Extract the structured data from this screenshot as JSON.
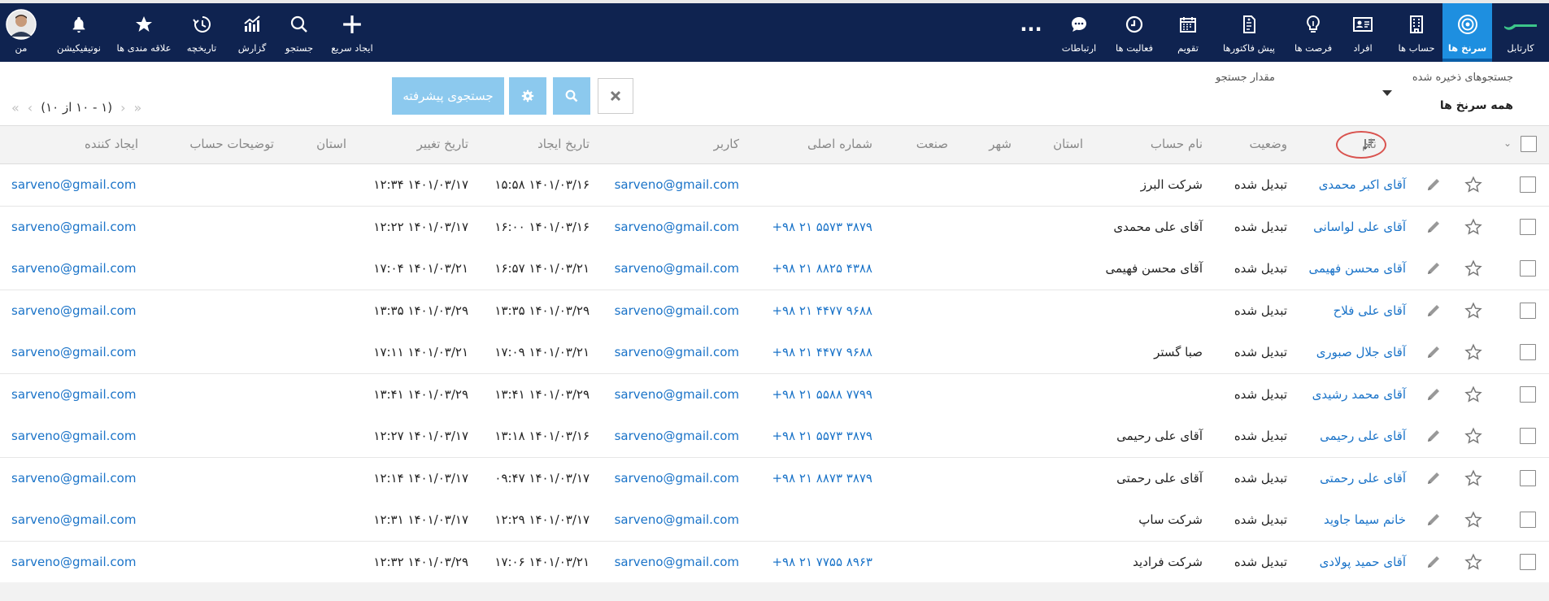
{
  "nav": {
    "items": [
      {
        "label": "کارتابل",
        "icon": "dashboard-logo-icon"
      },
      {
        "label": "سرنخ ها",
        "icon": "target-icon",
        "active": true
      },
      {
        "label": "حساب ها",
        "icon": "building-icon"
      },
      {
        "label": "افراد",
        "icon": "contact-card-icon"
      },
      {
        "label": "فرصت ها",
        "icon": "lightbulb-icon"
      },
      {
        "label": "پیش فاکتورها",
        "icon": "invoice-icon"
      },
      {
        "label": "تقویم",
        "icon": "calendar-icon"
      },
      {
        "label": "فعالیت ها",
        "icon": "clock-icon"
      },
      {
        "label": "ارتباطات",
        "icon": "chat-icon"
      }
    ],
    "more_label": "...",
    "tools": [
      {
        "label": "ایجاد سریع",
        "icon": "plus-icon"
      },
      {
        "label": "جستجو",
        "icon": "search-icon"
      },
      {
        "label": "گزارش",
        "icon": "chart-icon"
      },
      {
        "label": "تاریخچه",
        "icon": "history-icon"
      },
      {
        "label": "علاقه مندی ها",
        "icon": "star-icon"
      },
      {
        "label": "نوتیفیکیشن",
        "icon": "bell-icon"
      },
      {
        "label": "من",
        "icon": "avatar"
      }
    ],
    "accent_color": "#1e8fe0",
    "bar_color": "#0f2350"
  },
  "toolbar": {
    "saved_searches_label": "جستجوهای ذخیره شده",
    "saved_searches_value": "همه سرنخ ها",
    "search_value_label": "مقدار جستجو",
    "clear_icon": "close-icon",
    "search_icon": "search-icon",
    "settings_icon": "gear-icon",
    "advanced_search_label": "جستجوی پیشرفته",
    "pagination_text": "(۱ - ۱۰ از ۱۰)"
  },
  "table": {
    "headers": {
      "name": "نام",
      "status": "وضعیت",
      "account_name": "نام حساب",
      "province": "استان",
      "city": "شهر",
      "industry": "صنعت",
      "main_number": "شماره اصلی",
      "user": "کاربر",
      "created_date": "تاریخ ایجاد",
      "modified_date": "تاریخ تغییر",
      "province2": "استان",
      "account_description": "توضیحات حساب",
      "creator": "ایجاد کننده"
    },
    "rows": [
      {
        "name": "آقای اکبر محمدی",
        "status": "تبدیل شده",
        "account": "شرکت البرز",
        "phone": "",
        "user": "sarveno@gmail.com",
        "created": "۱۵:۵۸ ۱۴۰۱/۰۳/۱۶",
        "modified": "۱۲:۳۴ ۱۴۰۱/۰۳/۱۷",
        "creator": "sarveno@gmail.com"
      },
      {
        "name": "آقای علی لواسانی",
        "status": "تبدیل شده",
        "account": "آقای علی محمدی",
        "phone": "+۹۸ ۲۱ ۵۵۷۳ ۳۸۷۹",
        "user": "sarveno@gmail.com",
        "created": "۱۶:۰۰ ۱۴۰۱/۰۳/۱۶",
        "modified": "۱۲:۲۲ ۱۴۰۱/۰۳/۱۷",
        "creator": "sarveno@gmail.com"
      },
      {
        "name": "آقای محسن فهیمی",
        "status": "تبدیل شده",
        "account": "آقای محسن فهیمی",
        "phone": "+۹۸ ۲۱ ۸۸۲۵ ۴۳۸۸",
        "user": "sarveno@gmail.com",
        "created": "۱۶:۵۷ ۱۴۰۱/۰۳/۲۱",
        "modified": "۱۷:۰۴ ۱۴۰۱/۰۳/۲۱",
        "creator": "sarveno@gmail.com"
      },
      {
        "name": "آقای علی فلاح",
        "status": "تبدیل شده",
        "account": "",
        "phone": "+۹۸ ۲۱ ۴۴۷۷ ۹۶۸۸",
        "user": "sarveno@gmail.com",
        "created": "۱۳:۳۵ ۱۴۰۱/۰۳/۲۹",
        "modified": "۱۳:۳۵ ۱۴۰۱/۰۳/۲۹",
        "creator": "sarveno@gmail.com"
      },
      {
        "name": "آقای جلال صبوری",
        "status": "تبدیل شده",
        "account": "صبا گستر",
        "phone": "+۹۸ ۲۱ ۴۴۷۷ ۹۶۸۸",
        "user": "sarveno@gmail.com",
        "created": "۱۷:۰۹ ۱۴۰۱/۰۳/۲۱",
        "modified": "۱۷:۱۱ ۱۴۰۱/۰۳/۲۱",
        "creator": "sarveno@gmail.com"
      },
      {
        "name": "آقای محمد رشیدی",
        "status": "تبدیل شده",
        "account": "",
        "phone": "+۹۸ ۲۱ ۵۵۸۸ ۷۷۹۹",
        "user": "sarveno@gmail.com",
        "created": "۱۳:۴۱ ۱۴۰۱/۰۳/۲۹",
        "modified": "۱۳:۴۱ ۱۴۰۱/۰۳/۲۹",
        "creator": "sarveno@gmail.com"
      },
      {
        "name": "آقای علی رحیمی",
        "status": "تبدیل شده",
        "account": "آقای علی رحیمی",
        "phone": "+۹۸ ۲۱ ۵۵۷۳ ۳۸۷۹",
        "user": "sarveno@gmail.com",
        "created": "۱۳:۱۸ ۱۴۰۱/۰۳/۱۶",
        "modified": "۱۲:۲۷ ۱۴۰۱/۰۳/۱۷",
        "creator": "sarveno@gmail.com"
      },
      {
        "name": "آقای علی رحمتی",
        "status": "تبدیل شده",
        "account": "آقای علی رحمتی",
        "phone": "+۹۸ ۲۱ ۸۸۷۳ ۳۸۷۹",
        "user": "sarveno@gmail.com",
        "created": "۰۹:۴۷ ۱۴۰۱/۰۳/۱۷",
        "modified": "۱۲:۱۴ ۱۴۰۱/۰۳/۱۷",
        "creator": "sarveno@gmail.com"
      },
      {
        "name": "خانم سیما جاوید",
        "status": "تبدیل شده",
        "account": "شرکت ساپ",
        "phone": "",
        "user": "sarveno@gmail.com",
        "created": "۱۲:۲۹ ۱۴۰۱/۰۳/۱۷",
        "modified": "۱۲:۳۱ ۱۴۰۱/۰۳/۱۷",
        "creator": "sarveno@gmail.com"
      },
      {
        "name": "آقای حمید پولادی",
        "status": "تبدیل شده",
        "account": "شرکت فرادید",
        "phone": "+۹۸ ۲۱ ۷۷۵۵ ۸۹۶۳",
        "user": "sarveno@gmail.com",
        "created": "۱۷:۰۶ ۱۴۰۱/۰۳/۲۱",
        "modified": "۱۲:۳۲ ۱۴۰۱/۰۳/۲۹",
        "creator": "sarveno@gmail.com"
      }
    ],
    "link_color": "#1a73c8"
  }
}
